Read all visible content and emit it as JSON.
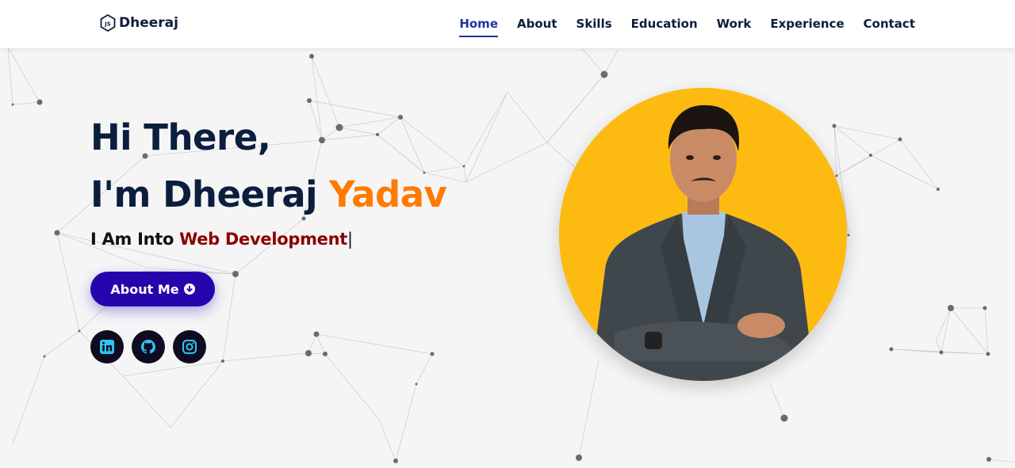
{
  "header": {
    "logo_text": "Dheeraj",
    "logo_icon": "nodejs-hexagon-icon",
    "nav": [
      {
        "label": "Home",
        "active": true
      },
      {
        "label": "About",
        "active": false
      },
      {
        "label": "Skills",
        "active": false
      },
      {
        "label": "Education",
        "active": false
      },
      {
        "label": "Work",
        "active": false
      },
      {
        "label": "Experience",
        "active": false
      },
      {
        "label": "Contact",
        "active": false
      }
    ]
  },
  "hero": {
    "greeting": "Hi There,",
    "intro": "I'm Dheeraj ",
    "name_accent": "Yadav",
    "tagline_prefix": "I Am Into ",
    "tagline_typed": "Web Development",
    "tagline_cursor": "|",
    "cta_label": "About Me",
    "cta_icon": "arrow-down-circle-icon",
    "socials": [
      {
        "name": "linkedin",
        "icon": "linkedin-icon"
      },
      {
        "name": "github",
        "icon": "github-icon"
      },
      {
        "name": "instagram",
        "icon": "instagram-icon"
      }
    ],
    "photo_alt": "portrait-photo"
  },
  "colors": {
    "navy": "#0b1e3d",
    "accent_orange": "#ff7a00",
    "typed_red": "#8b0000",
    "cta_blue": "#2506ad",
    "nav_active": "#2332a6",
    "photo_bg": "#fdbb12",
    "social_bg": "#0e0b22",
    "social_icon": "#2ec5f2"
  }
}
